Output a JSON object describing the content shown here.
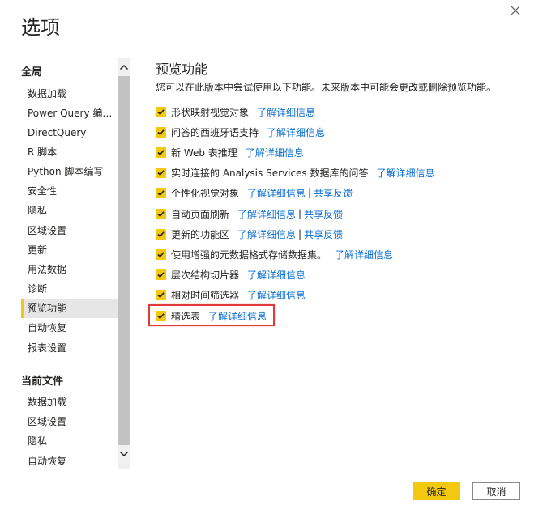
{
  "dialog": {
    "title": "选项"
  },
  "sidebar": {
    "global_header": "全局",
    "global_items": [
      "数据加载",
      "Power Query 编辑...",
      "DirectQuery",
      "R 脚本",
      "Python 脚本编写",
      "安全性",
      "隐私",
      "区域设置",
      "更新",
      "用法数据",
      "诊断",
      "预览功能",
      "自动恢复",
      "报表设置"
    ],
    "selected_item": "预览功能",
    "file_header": "当前文件",
    "file_items": [
      "数据加载",
      "区域设置",
      "隐私",
      "自动恢复"
    ]
  },
  "main": {
    "title": "预览功能",
    "description": "您可以在此版本中尝试使用以下功能。未来版本中可能会更改或删除预览功能。",
    "learn_more": "了解详细信息",
    "share_feedback": "共享反馈",
    "separator": "|",
    "options": [
      {
        "label": "形状映射视觉对象",
        "checked": true
      },
      {
        "label": "问答的西班牙语支持",
        "checked": true
      },
      {
        "label": "新 Web 表推理",
        "checked": true
      },
      {
        "label": "实时连接的 Analysis Services 数据库的问答",
        "checked": true
      },
      {
        "label": "个性化视觉对象",
        "checked": true
      },
      {
        "label": "自动页面刷新",
        "checked": true
      },
      {
        "label": "更新的功能区",
        "checked": true
      },
      {
        "label": "使用增强的元数据格式存储数据集。",
        "checked": true
      },
      {
        "label": "层次结构切片器",
        "checked": true
      },
      {
        "label": "相对时间筛选器",
        "checked": true
      },
      {
        "label": "精选表",
        "checked": true
      }
    ]
  },
  "buttons": {
    "ok": "确定",
    "cancel": "取消"
  },
  "colors": {
    "accent": "#f2c811",
    "link": "#0a6ed1",
    "highlight": "#e03a3a"
  }
}
